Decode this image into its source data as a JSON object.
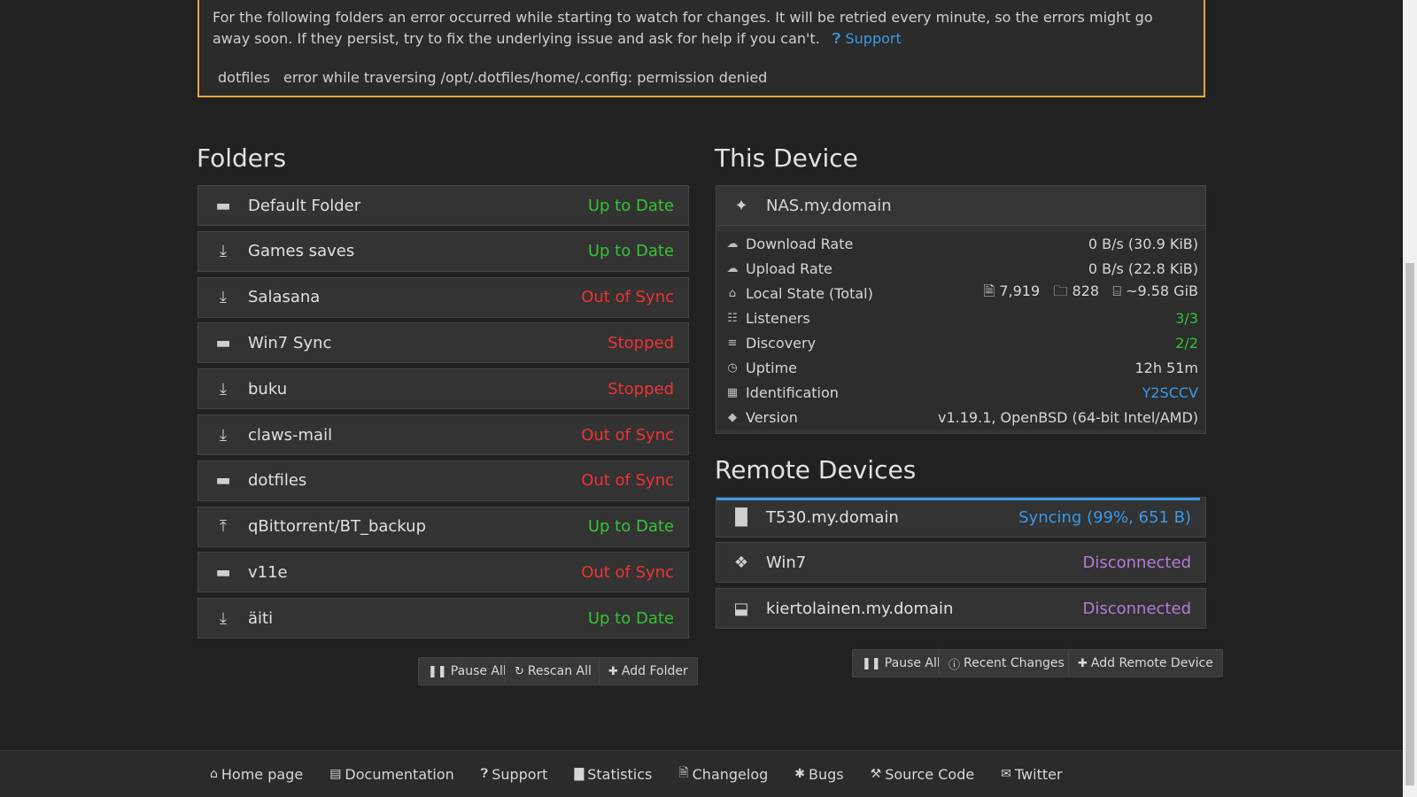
{
  "alert": {
    "message": "For the following folders an error occurred while starting to watch for changes. It will be retried every minute, so the errors might go away soon. If they persist, try to fix the underlying issue and ask for help if you can't.",
    "support_link": "Support",
    "error_folder": "dotfiles",
    "error_text": "error while traversing /opt/.dotfiles/home/.config: permission denied"
  },
  "folders": {
    "heading": "Folders",
    "items": [
      {
        "name": "Default Folder",
        "status": "Up to Date",
        "icon": "folder-icon"
      },
      {
        "name": "Games saves",
        "status": "Up to Date",
        "icon": "download-icon"
      },
      {
        "name": "Salasana",
        "status": "Out of Sync",
        "icon": "download-icon"
      },
      {
        "name": "Win7 Sync",
        "status": "Stopped",
        "icon": "folder-icon"
      },
      {
        "name": "buku",
        "status": "Stopped",
        "icon": "download-icon"
      },
      {
        "name": "claws-mail",
        "status": "Out of Sync",
        "icon": "download-icon"
      },
      {
        "name": "dotfiles",
        "status": "Out of Sync",
        "icon": "folder-icon"
      },
      {
        "name": "qBittorrent/BT_backup",
        "status": "Up to Date",
        "icon": "upload-icon"
      },
      {
        "name": "v11e",
        "status": "Out of Sync",
        "icon": "folder-icon"
      },
      {
        "name": "äiti",
        "status": "Up to Date",
        "icon": "download-icon"
      }
    ],
    "buttons": {
      "pause_all": "Pause All",
      "rescan_all": "Rescan All",
      "add_folder": "Add Folder"
    }
  },
  "this_device": {
    "heading": "This Device",
    "name": "NAS.my.domain",
    "rows": [
      {
        "label": "Download Rate",
        "value": "0 B/s (30.9 KiB)"
      },
      {
        "label": "Upload Rate",
        "value": "0 B/s (22.8 KiB)"
      },
      {
        "label": "Local State (Total)",
        "files": "7,919",
        "dirs": "828",
        "size": "~9.58 GiB"
      },
      {
        "label": "Listeners",
        "value": "3/3"
      },
      {
        "label": "Discovery",
        "value": "2/2"
      },
      {
        "label": "Uptime",
        "value": "12h 51m"
      },
      {
        "label": "Identification",
        "value": "Y2SCCV"
      },
      {
        "label": "Version",
        "value": "v1.19.1, OpenBSD (64-bit Intel/AMD)"
      }
    ]
  },
  "remote_devices": {
    "heading": "Remote Devices",
    "items": [
      {
        "name": "T530.my.domain",
        "status": "Syncing (99%, 651 B)",
        "progress": 0.99
      },
      {
        "name": "Win7",
        "status": "Disconnected"
      },
      {
        "name": "kiertolainen.my.domain",
        "status": "Disconnected"
      }
    ],
    "buttons": {
      "pause_all": "Pause All",
      "recent_changes": "Recent Changes",
      "add_remote": "Add Remote Device"
    }
  },
  "footer": {
    "links": [
      "Home page",
      "Documentation",
      "Support",
      "Statistics",
      "Changelog",
      "Bugs",
      "Source Code",
      "Twitter"
    ]
  },
  "colors": {
    "ok": "#35c235",
    "error": "#e33333",
    "link": "#3a9ae8",
    "disconnected": "#b57ad8",
    "alert_border": "#e8a33e"
  }
}
